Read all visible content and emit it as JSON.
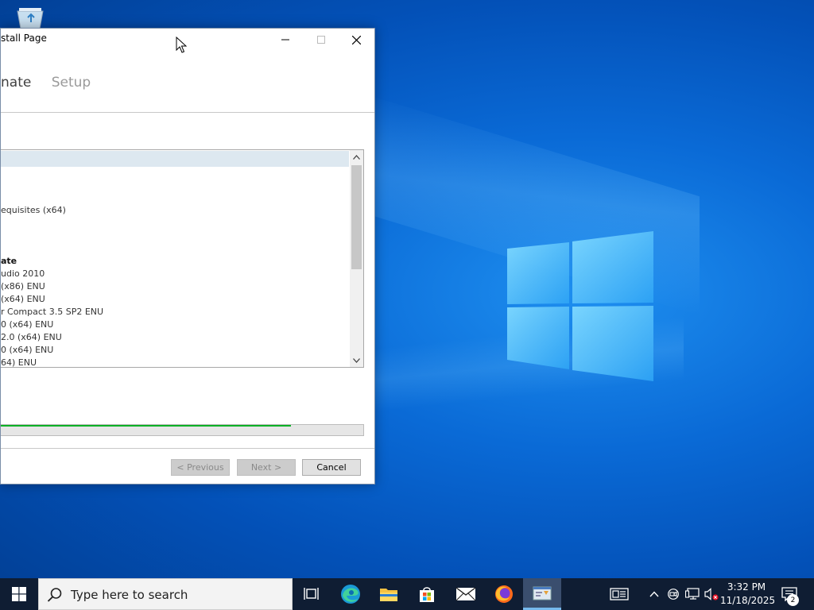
{
  "window": {
    "title": "stall Page",
    "steps": {
      "current": "nate",
      "next": "Setup"
    },
    "list_items": [
      {
        "text": "",
        "bold": false,
        "selected": true
      },
      {
        "text": "equisites (x64)",
        "bold": false
      },
      {
        "text": "ate",
        "bold": true
      },
      {
        "text": "udio 2010",
        "bold": false
      },
      {
        "text": " (x86) ENU",
        "bold": false
      },
      {
        "text": " (x64) ENU",
        "bold": false
      },
      {
        "text": "r Compact 3.5 SP2 ENU",
        "bold": false
      },
      {
        "text": "0 (x64) ENU",
        "bold": false
      },
      {
        "text": "2.0 (x64) ENU",
        "bold": false
      },
      {
        "text": "0 (x64) ENU",
        "bold": false
      },
      {
        "text": "64) ENU",
        "bold": false
      }
    ],
    "progress_fraction": 0.8,
    "buttons": {
      "previous": "< Previous",
      "next": "Next >",
      "cancel": "Cancel"
    }
  },
  "taskbar": {
    "search_placeholder": "Type here to search",
    "pinned_icons": [
      "task-view-icon",
      "edge-icon",
      "file-explorer-icon",
      "store-icon",
      "mail-icon",
      "firefox-icon",
      "installer-icon"
    ],
    "tray_icons": [
      "news-icon",
      "chevron-up-icon",
      "meet-now-icon",
      "network-icon",
      "volume-muted-icon"
    ],
    "time": "3:32 PM",
    "date": "11/18/2025",
    "notification_count": "2"
  },
  "colors": {
    "desktop_blue": "#0a6ad6",
    "taskbar": "#0f1d33",
    "progress_green": "#06b025"
  }
}
